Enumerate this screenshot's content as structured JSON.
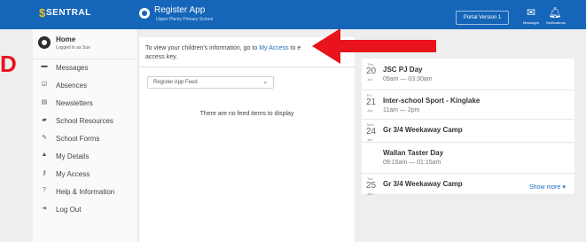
{
  "topbar": {
    "brand": "SENTRAL",
    "brand_mark": "$",
    "app_title": "Register App",
    "app_subtitle": "Upper Plenty Primary School",
    "portal_button": "Portal Version 1",
    "messages_label": "Messages",
    "notifications_label": "Notifications",
    "messages_icon": "mail-icon",
    "notifications_icon": "bell-icon"
  },
  "annotation": {
    "letter": "D",
    "color": "#e8131b"
  },
  "sidebar": {
    "home_label": "Home",
    "home_sub": "Logged in as Sue",
    "items": [
      {
        "label": "Messages",
        "icon": "envelope-icon",
        "glyph": "▬"
      },
      {
        "label": "Absences",
        "icon": "check-icon",
        "glyph": "☑"
      },
      {
        "label": "Newsletters",
        "icon": "newspaper-icon",
        "glyph": "▤"
      },
      {
        "label": "School Resources",
        "icon": "folder-icon",
        "glyph": "▰"
      },
      {
        "label": "School Forms",
        "icon": "form-icon",
        "glyph": "✎"
      },
      {
        "label": "My Details",
        "icon": "user-icon",
        "glyph": "▲"
      },
      {
        "label": "My Access",
        "icon": "key-icon",
        "glyph": "⚷"
      },
      {
        "label": "Help & Information",
        "icon": "question-icon",
        "glyph": "?"
      },
      {
        "label": "Log Out",
        "icon": "logout-icon",
        "glyph": "➜"
      }
    ]
  },
  "main": {
    "notice_before": "To view your children's information, go to ",
    "notice_link": "My Access",
    "notice_after": " to e",
    "notice_line2": "access key.",
    "feed_select": "Register App Feed",
    "empty_message": "There are no feed items to display"
  },
  "events": {
    "show_more": "Show more",
    "items": [
      {
        "dow": "Thu",
        "day": "20",
        "month": "Jun",
        "title": "JSC PJ Day",
        "time": "09am — 03:30am"
      },
      {
        "dow": "Fri",
        "day": "21",
        "month": "Jun",
        "title": "Inter-school Sport - Kinglake",
        "time": "11am — 2pm"
      },
      {
        "dow": "Mon",
        "day": "24",
        "month": "Jun",
        "title": "Gr 3/4 Weekaway Camp",
        "time": ""
      },
      {
        "dow": "",
        "day": "",
        "month": "",
        "title": "Wallan Taster Day",
        "time": "09:15am — 01:15am"
      },
      {
        "dow": "Tue",
        "day": "25",
        "month": "Jun",
        "title": "Gr 3/4 Weekaway Camp",
        "time": ""
      }
    ]
  },
  "colors": {
    "topbar": "#1565b8",
    "link": "#1a6bc2",
    "arrow": "#e8131b"
  }
}
